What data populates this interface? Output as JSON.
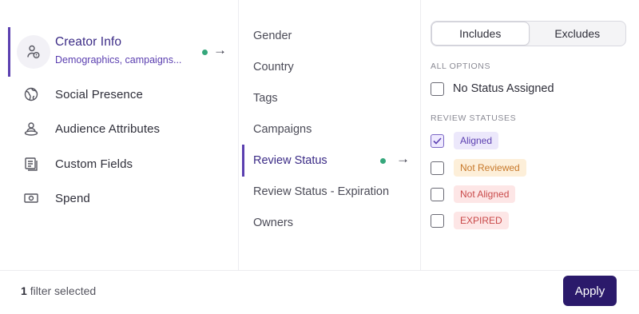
{
  "categories": [
    {
      "label": "Creator Info",
      "subtitle": "Demographics, campaigns...",
      "icon": "creator-info-icon",
      "active": true
    },
    {
      "label": "Social Presence",
      "icon": "globe-icon"
    },
    {
      "label": "Audience Attributes",
      "icon": "audience-icon"
    },
    {
      "label": "Custom Fields",
      "icon": "custom-fields-icon"
    },
    {
      "label": "Spend",
      "icon": "money-icon"
    }
  ],
  "fields": [
    {
      "label": "Gender"
    },
    {
      "label": "Country"
    },
    {
      "label": "Tags"
    },
    {
      "label": "Campaigns"
    },
    {
      "label": "Review Status",
      "active": true
    },
    {
      "label": "Review Status - Expiration"
    },
    {
      "label": "Owners"
    }
  ],
  "toggle": {
    "includes": "Includes",
    "excludes": "Excludes",
    "selected": "Includes"
  },
  "all_options": {
    "title": "ALL OPTIONS",
    "items": [
      {
        "label": "No Status Assigned",
        "checked": false
      }
    ]
  },
  "review_statuses": {
    "title": "REVIEW STATUSES",
    "items": [
      {
        "label": "Aligned",
        "checked": true,
        "bg": "#ece8fb",
        "fg": "#5b3fb0"
      },
      {
        "label": "Not Reviewed",
        "checked": false,
        "bg": "#fdefd9",
        "fg": "#c7782a"
      },
      {
        "label": "Not Aligned",
        "checked": false,
        "bg": "#fde6e6",
        "fg": "#c94a4a"
      },
      {
        "label": "EXPIRED",
        "checked": false,
        "bg": "#fde6e6",
        "fg": "#c94a4a"
      }
    ]
  },
  "footer": {
    "count": "1",
    "summary_text": "filter selected",
    "apply_label": "Apply"
  },
  "colors": {
    "accent": "#5b3fb0",
    "active_dot": "#35a77b",
    "apply_bg": "#2b1a6b"
  }
}
